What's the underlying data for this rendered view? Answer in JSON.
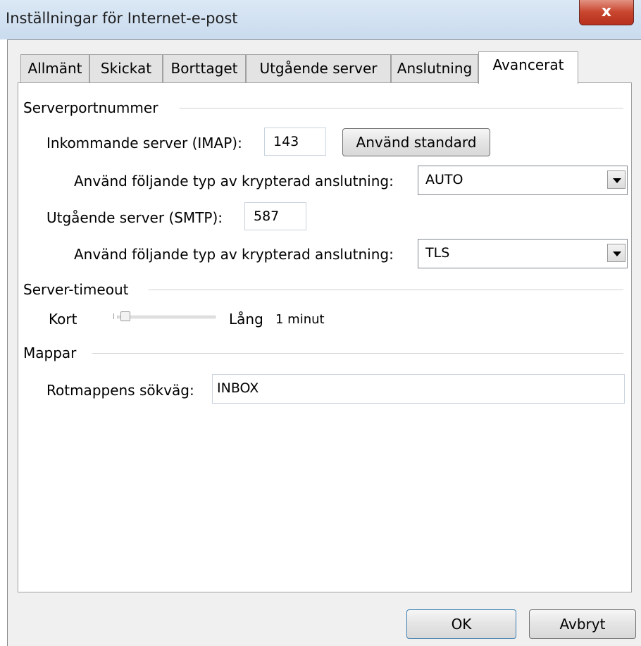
{
  "window": {
    "title": "Inställningar för Internet-e-post",
    "close_glyph": "x"
  },
  "tabs": [
    {
      "label": "Allmänt"
    },
    {
      "label": "Skickat"
    },
    {
      "label": "Borttaget"
    },
    {
      "label": "Utgående server"
    },
    {
      "label": "Anslutning"
    },
    {
      "label": "Avancerat",
      "active": true
    }
  ],
  "server_ports": {
    "group_label": "Serverportnummer",
    "incoming_label": "Inkommande server (IMAP):",
    "incoming_port": "143",
    "use_default_label": "Använd standard",
    "incoming_encryption_label": "Använd följande typ av krypterad anslutning:",
    "incoming_encryption_value": "AUTO",
    "outgoing_label": "Utgående server (SMTP):",
    "outgoing_port": "587",
    "outgoing_encryption_label": "Använd följande typ av krypterad anslutning:",
    "outgoing_encryption_value": "TLS"
  },
  "timeout": {
    "group_label": "Server-timeout",
    "short_label": "Kort",
    "long_label": "Lång",
    "value_label": "1 minut",
    "slider_position": 0
  },
  "folders": {
    "group_label": "Mappar",
    "root_path_label": "Rotmappens sökväg:",
    "root_path_value": "INBOX"
  },
  "footer": {
    "ok_label": "OK",
    "cancel_label": "Avbryt"
  },
  "icons": {
    "dropdown": "chevron-down-icon",
    "close": "close-icon"
  }
}
